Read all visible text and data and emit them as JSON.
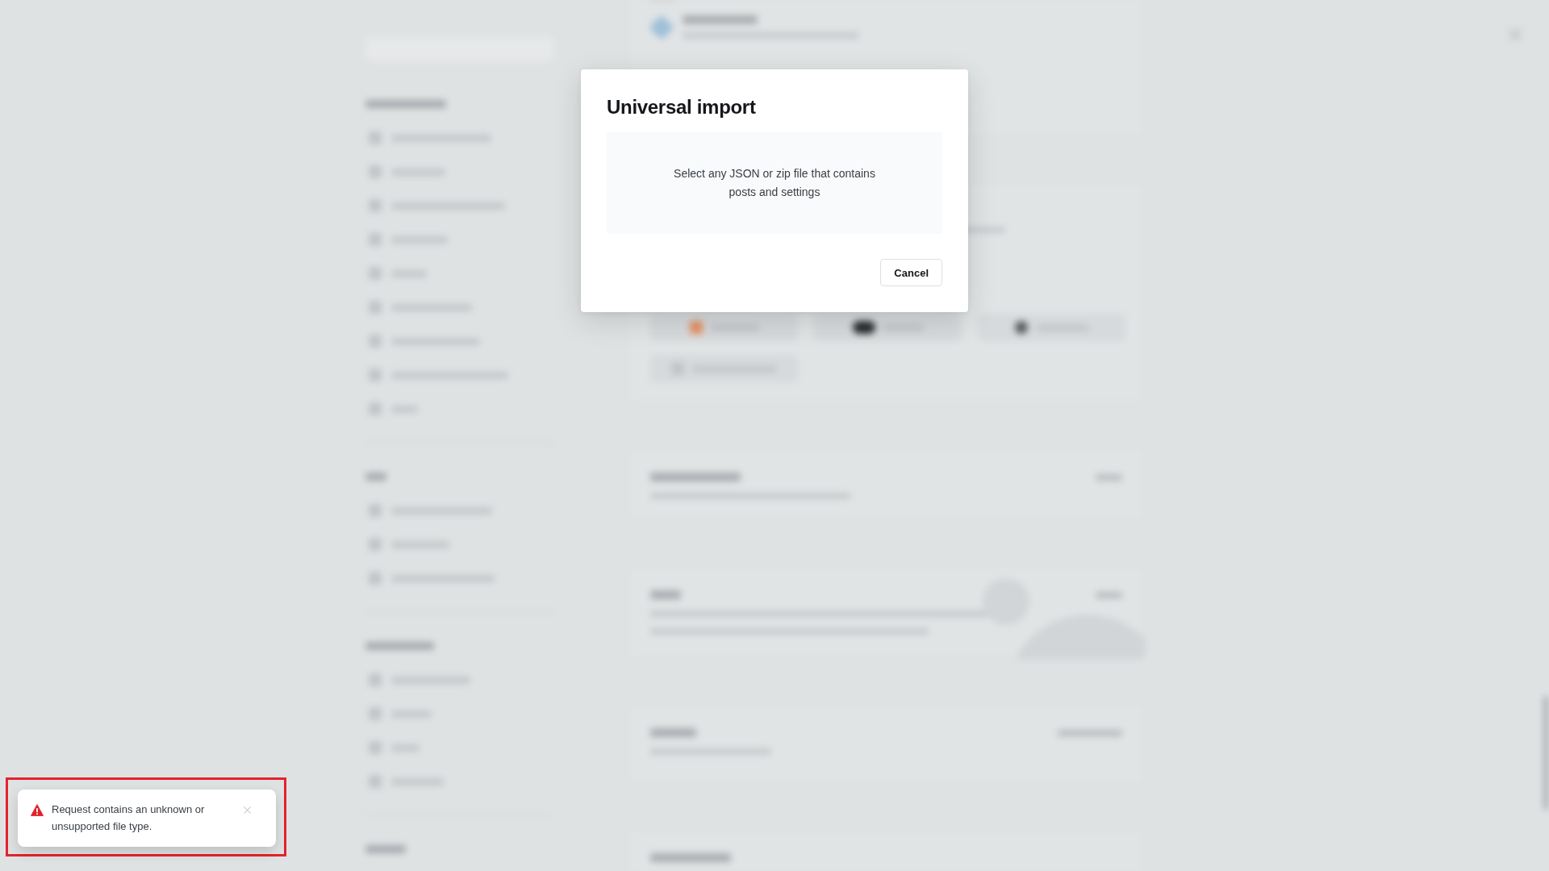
{
  "dialog": {
    "title": "Universal import",
    "drop_zone": {
      "text": "Select any JSON or zip file that contains posts and settings"
    },
    "buttons": [
      {
        "label": "Cancel",
        "kind": "secondary"
      }
    ]
  },
  "toast": {
    "kind": "error",
    "message": "Request contains an unknown or unsupported file type.",
    "highlighted": true
  }
}
